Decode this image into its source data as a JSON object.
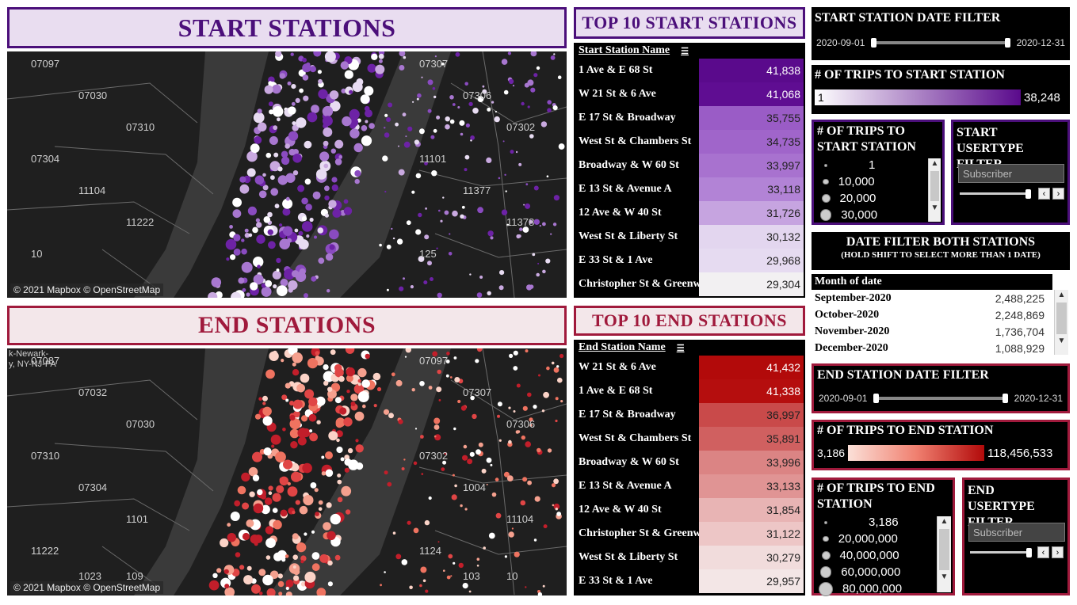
{
  "start": {
    "banner": "START STATIONS",
    "map_attribution": "© 2021 Mapbox © OpenStreetMap",
    "zip_labels": [
      "07097",
      "07307",
      "07030",
      "07306",
      "07310",
      "07302",
      "07304",
      "11101",
      "11104",
      "11377",
      "11222",
      "11378",
      "10",
      "125"
    ],
    "top10_title": "TOP 10 START STATIONS",
    "col_header": "Start Station Name",
    "rows": [
      {
        "name": "1 Ave & E 68 St",
        "value": "41,838",
        "color": "#5a0a8c"
      },
      {
        "name": "W 21 St & 6 Ave",
        "value": "41,068",
        "color": "#5f0d92"
      },
      {
        "name": "E 17 St & Broadway",
        "value": "35,755",
        "color": "#9a5cc6"
      },
      {
        "name": "West St & Chambers St",
        "value": "34,735",
        "color": "#a065ca"
      },
      {
        "name": "Broadway & W 60 St",
        "value": "33,997",
        "color": "#a872cf"
      },
      {
        "name": "E 13 St & Avenue A",
        "value": "33,118",
        "color": "#b283d6"
      },
      {
        "name": "12 Ave & W 40 St",
        "value": "31,726",
        "color": "#c6a4e0"
      },
      {
        "name": "West St & Liberty St",
        "value": "30,132",
        "color": "#e3d6ef"
      },
      {
        "name": "E 33 St & 1 Ave",
        "value": "29,968",
        "color": "#e6dbf1"
      },
      {
        "name": "Christopher St & Greenw..",
        "value": "29,304",
        "color": "#f2f0f2"
      }
    ],
    "date_filter": {
      "title": "START STATION DATE FILTER",
      "from": "2020-09-01",
      "to": "2020-12-31"
    },
    "trips_color": {
      "title": "# OF TRIPS TO START STATION",
      "min": "1",
      "max": "38,248"
    },
    "size_legend": {
      "title": "# OF TRIPS TO START STATION",
      "items": [
        "1",
        "10,000",
        "20,000",
        "30,000"
      ]
    },
    "usertype": {
      "title": "START USERTYPE FILTER",
      "value": "Subscriber"
    }
  },
  "end": {
    "banner": "END STATIONS",
    "map_attribution": "© 2021 Mapbox © OpenStreetMap",
    "region_label_1": "k-Newark-",
    "region_label_2": "y, NY-NJ-PA",
    "zip_labels": [
      "07087",
      "07097",
      "07032",
      "07307",
      "07030",
      "07306",
      "07310",
      "07302",
      "07304",
      "1004",
      "1101",
      "11104",
      "11222",
      "1124",
      "1023",
      "103",
      "109",
      "10"
    ],
    "top10_title": "TOP 10 END STATIONS",
    "col_header": "End Station Name",
    "rows": [
      {
        "name": "W 21 St & 6 Ave",
        "value": "41,432",
        "color": "#b20a0a"
      },
      {
        "name": "1 Ave & E 68 St",
        "value": "41,338",
        "color": "#b50e0e"
      },
      {
        "name": "E 17 St & Broadway",
        "value": "36,997",
        "color": "#c94a4a"
      },
      {
        "name": "West St & Chambers St",
        "value": "35,891",
        "color": "#d06060"
      },
      {
        "name": "Broadway & W 60 St",
        "value": "33,996",
        "color": "#db8484"
      },
      {
        "name": "E 13 St & Avenue A",
        "value": "33,133",
        "color": "#e09494"
      },
      {
        "name": "12 Ave & W 40 St",
        "value": "31,854",
        "color": "#e8b4b4"
      },
      {
        "name": "Christopher St & Greenw..",
        "value": "31,122",
        "color": "#edc6c6"
      },
      {
        "name": "West St & Liberty St",
        "value": "30,279",
        "color": "#f1dcdc"
      },
      {
        "name": "E 33 St & 1 Ave",
        "value": "29,957",
        "color": "#f3e6e6"
      }
    ],
    "date_filter": {
      "title": "END STATION DATE FILTER",
      "from": "2020-09-01",
      "to": "2020-12-31"
    },
    "trips_color": {
      "title": "# OF TRIPS TO END STATION",
      "min": "3,186",
      "max": "118,456,533"
    },
    "size_legend": {
      "title": "# OF TRIPS TO END STATION",
      "items": [
        "3,186",
        "20,000,000",
        "40,000,000",
        "60,000,000",
        "80,000,000"
      ]
    },
    "usertype": {
      "title": "END USERTYPE FILTER",
      "value": "Subscriber"
    }
  },
  "both_filter": {
    "title": "DATE FILTER BOTH STATIONS",
    "subtitle": "(HOLD SHIFT TO SELECT MORE THAN 1 DATE)",
    "col_header": "Month of date",
    "months": [
      {
        "month": "September-2020",
        "value": "2,488,225"
      },
      {
        "month": "October-2020",
        "value": "2,248,869"
      },
      {
        "month": "November-2020",
        "value": "1,736,704"
      },
      {
        "month": "December-2020",
        "value": "1,088,929"
      }
    ]
  },
  "icons": {
    "sort": "sort-icon",
    "prev": "‹",
    "next": "›",
    "up": "▲",
    "down": "▼"
  },
  "colors": {
    "start_accent": "#4b0f7a",
    "start_bg": "#e9ddf0",
    "end_accent": "#a01a3c",
    "end_bg": "#f3e7ea"
  }
}
